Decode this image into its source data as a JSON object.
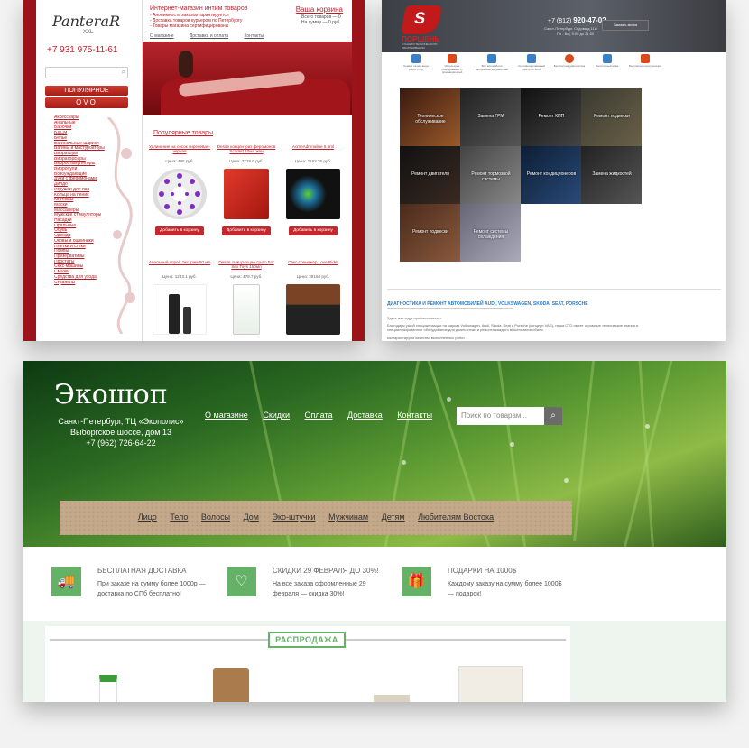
{
  "card1": {
    "logo": "PanteraR",
    "logo_sub": "XXL",
    "phone": "+7 931 975-11-61",
    "popular_btn": "ПОПУЛЯРНОЕ",
    "ovo_btn": "OVO",
    "categories": [
      "Аксессуары",
      "Анальные",
      "Бабочки",
      "БДСМ",
      "Белье",
      "Вагинальные шарики",
      "Вагины и мастурбаторы",
      "Вибраторы",
      "ВибраторБары",
      "Вибростимуляторы",
      "Вибропули",
      "Возбуждающие",
      "Духи с феромонами",
      "Дилдо",
      "Игрушки для пар",
      "Кольца на пенис",
      "Костюмы",
      "Маски",
      "Массажеры",
      "Мужские стимуляторы",
      "Насадки",
      "Оральные",
      "Обувь",
      "Одежда",
      "Оковы и ошейники",
      "Плётки и стеки",
      "Помпы",
      "Презервативы",
      "Простаты",
      "Секс-машины",
      "Смазки",
      "Средства для ухода",
      "Страпоны"
    ],
    "headline": "Интернет-магазин интим товаров",
    "bullets": [
      "- Анонимность заказов гарантируется",
      "- Доставка товаров курьером по Петербургу",
      "- Товары магазина сертифицированы"
    ],
    "cart_title": "Ваша корзина",
    "cart_items": "Всего товаров — 0",
    "cart_sum": "На сумму — 0 руб.",
    "nav": [
      "О магазине",
      "Доставка и оплата",
      "Контакты"
    ],
    "section_title": "Популярные товары",
    "products_row1": [
      {
        "title": "Удлинение на сосок сиреневая-черная",
        "price": "Цена: 495 руб."
      },
      {
        "title": "Desire концентрат феромонов Scarlett 10мл жен",
        "price": "Цена: 2219.6 руб."
      },
      {
        "title": "AcmeAdrenaline 5,5ml",
        "price": "Цена: 2162.25 руб."
      }
    ],
    "products_row2": [
      {
        "title": "Анальный спрей Экстрим 50 мл",
        "price": "Цена: 1243.1 руб."
      },
      {
        "title": "Desire очищающее ср-во For Sex Toys 150мл",
        "price": "Цена: 479.7 руб."
      },
      {
        "title": "Секс-тренажер Love Rider",
        "price": "Цена: 28160 руб."
      }
    ],
    "add_label": "Добавить в корзину"
  },
  "card2": {
    "logo_letter": "S",
    "logo_title": "ПОРШЕНЬ",
    "logo_sub": "СТАНЦИЯ ТЕХНИЧЕСКОГО ОБСЛУЖИВАНИЯ",
    "phone_prefix": "+7 (812)",
    "phone": "920-47-02",
    "address": "Санкт-Петербург, Седова д.11И",
    "hours": "Пн - Вс | 9:00 до 21:00",
    "callback": "Заказать звонок",
    "features": [
      "Сервис на все виды работ 1 год",
      "Используем оборудование от производителей",
      "Все автомобили оформлены документами",
      "Сертифицированный центр по VAG",
      "Бесплатная диагностика",
      "Бесплатный кофе",
      "Бесплатная консультация"
    ],
    "tiles": [
      "Техническое обслуживание",
      "Замена ГРМ",
      "Ремонт КПП",
      "Ремонт подвески",
      "Ремонт двигателя",
      "Ремонт тормозной системы",
      "Ремонт кондиционеров",
      "Замена жидкостей",
      "Ремонт подвески",
      "Ремонт системы охлаждения"
    ],
    "article_title": "ДИАГНОСТИКА И РЕМОНТ АВТОМОБИЛЕЙ AUDI, VOLKSWAGEN, SKODA, SEAT, PORSCHE",
    "article_p1": "Здесь вас ждут профессионалы.",
    "article_p2": "Благодаря узкой специализации на марках Volkswagen, Audi, Skoda, Seat и Porsche (концерн VAG), наша СТО имеет огромные технические знания и специализированное оборудование для диагностики и ремонта каждого вашего автомобиля",
    "article_p3": "мы гарантируем качество выполненных работ"
  },
  "card3": {
    "logo": "Экошоп",
    "address": [
      "Санкт-Петербург, ТЦ «Экополис»",
      "Выборгское шоссе, дом 13",
      "+7 (962) 726-64-22"
    ],
    "menu": [
      "О магазине",
      "Скидки",
      "Оплата",
      "Доставка",
      "Контакты"
    ],
    "search_placeholder": "Поиск по товарам...",
    "categories": [
      "Лицо",
      "Тело",
      "Волосы",
      "Дом",
      "Эко-штучки",
      "Мужчинам",
      "Детям",
      "Любителям Востока"
    ],
    "benefits": [
      {
        "title": "БЕСПЛАТНАЯ ДОСТАВКА",
        "text": "При заказе на сумму более 1000р — доставка по СПб бесплатно!",
        "icon": "truck-icon"
      },
      {
        "title": "СКИДКИ 29 ФЕВРАЛЯ ДО 30%!",
        "text": "На все заказа оформленные 29 февраля — скидка 30%!",
        "icon": "heart-icon"
      },
      {
        "title": "ПОДАРКИ НА 1000$",
        "text": "Каждому заказу на сумму более 1000$ — подарок!",
        "icon": "gift-icon"
      }
    ],
    "sale_label": "РАСПРОДАЖА",
    "accent": "#64b167"
  }
}
